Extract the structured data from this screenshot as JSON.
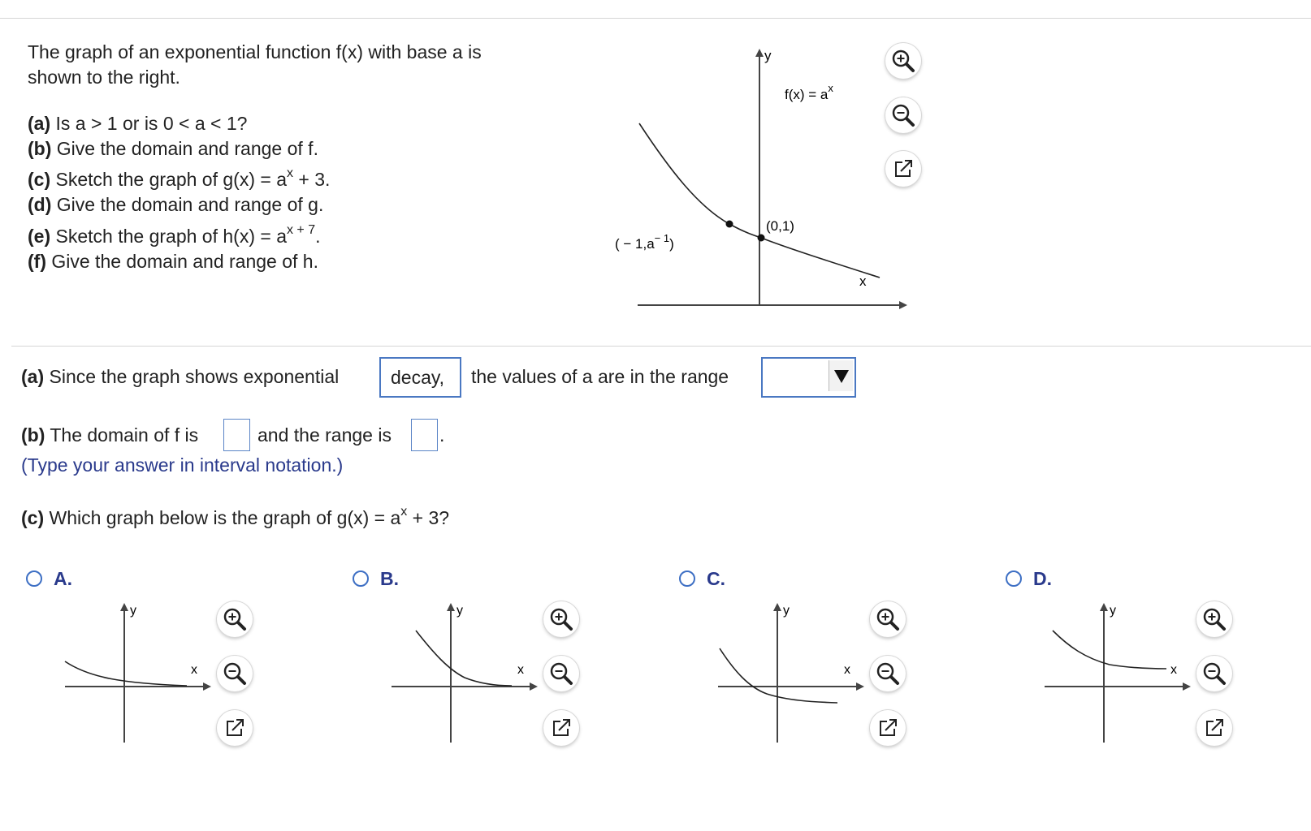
{
  "question": {
    "intro_line1": "The graph of an exponential function f(x) with base a is",
    "intro_line2": "shown to the right.",
    "parts": [
      {
        "tag": "(a)",
        "text": " Is a > 1 or is 0 < a < 1?"
      },
      {
        "tag": "(b)",
        "text": " Give the domain and range of f."
      },
      {
        "tag": "(c)",
        "text": " Sketch the graph of g(x) = a",
        "sup": "x",
        "tail": " + 3."
      },
      {
        "tag": "(d)",
        "text": " Give the domain and range of g."
      },
      {
        "tag": "(e)",
        "text": " Sketch the graph of h(x) = a",
        "sup": "x + 7",
        "tail": "."
      },
      {
        "tag": "(f)",
        "text": " Give the domain and range of h."
      }
    ]
  },
  "main_graph": {
    "y_label": "y",
    "x_label": "x",
    "func_label": "f(x) = a",
    "func_sup": "x",
    "point1_label": "(0,1)",
    "point2_label": "( − 1,a",
    "point2_sup": "− 1",
    "point2_tail": ")"
  },
  "answers": {
    "a_tag": "(a)",
    "a_text": " Since the graph shows exponential",
    "a_box_value": "decay,",
    "a_text2": "the values of a are in the range",
    "a_dropdown_value": "",
    "b_tag": "(b)",
    "b_text": " The domain of f is",
    "b_text2": "and the range is",
    "b_period": ".",
    "b_hint": "(Type your answer in interval notation.)",
    "c_tag": "(c)",
    "c_text": " Which graph below is the graph of g(x) = a",
    "c_sup": "x",
    "c_tail": " + 3?"
  },
  "options": [
    {
      "label": "A.",
      "y_label": "y",
      "x_label": "x",
      "selected": false
    },
    {
      "label": "B.",
      "y_label": "y",
      "x_label": "x",
      "selected": false
    },
    {
      "label": "C.",
      "y_label": "y",
      "x_label": "x",
      "selected": false
    },
    {
      "label": "D.",
      "y_label": "y",
      "x_label": "x",
      "selected": false
    }
  ],
  "icons": {
    "zoom_in": "zoom-in-icon",
    "zoom_out": "zoom-out-icon",
    "open_new": "open-window-icon"
  },
  "colors": {
    "accent": "#4a78c2",
    "hint": "#2a3a8c",
    "option_label": "#2a3a8c"
  }
}
